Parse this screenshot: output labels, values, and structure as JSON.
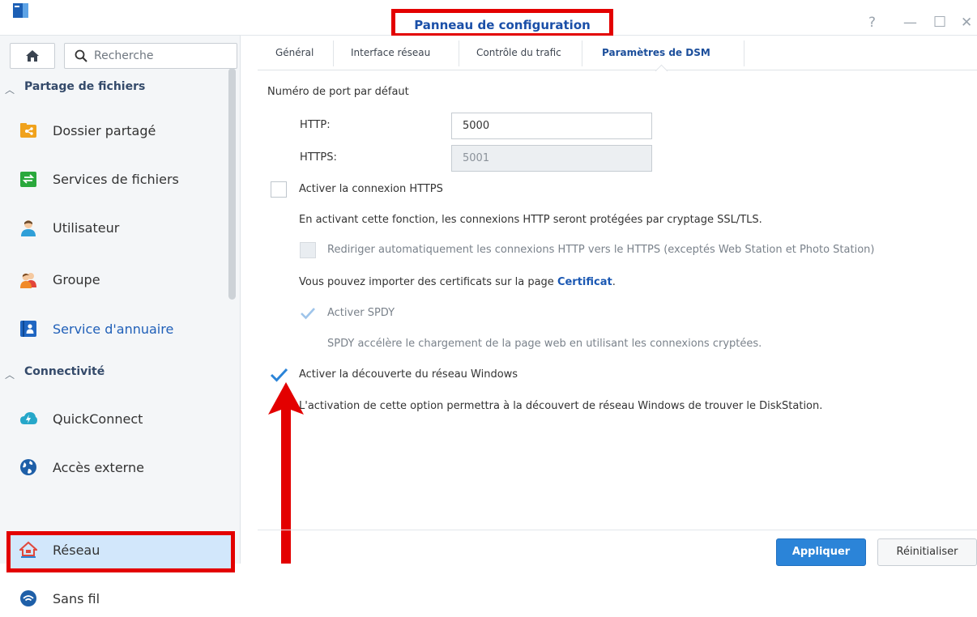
{
  "window": {
    "title": "Panneau de configuration",
    "controls": {
      "help": "?",
      "minimize": "—",
      "maximize": "□",
      "close": "✕"
    }
  },
  "sidebar": {
    "search_placeholder": "Recherche",
    "sections": [
      {
        "title": "Partage de fichiers",
        "items": [
          {
            "label": "Dossier partagé",
            "icon": "shared-folder-icon"
          },
          {
            "label": "Services de fichiers",
            "icon": "file-services-icon"
          },
          {
            "label": "Utilisateur",
            "icon": "user-icon"
          },
          {
            "label": "Groupe",
            "icon": "group-icon"
          },
          {
            "label": "Service d'annuaire",
            "icon": "directory-service-icon"
          }
        ]
      },
      {
        "title": "Connectivité",
        "items": [
          {
            "label": "QuickConnect",
            "icon": "quickconnect-icon"
          },
          {
            "label": "Accès externe",
            "icon": "external-access-icon"
          },
          {
            "label": "Réseau",
            "icon": "network-icon",
            "selected": true
          },
          {
            "label": "Sans fil",
            "icon": "wireless-icon"
          }
        ]
      }
    ]
  },
  "tabs": [
    {
      "label": "Général"
    },
    {
      "label": "Interface réseau"
    },
    {
      "label": "Contrôle du trafic"
    },
    {
      "label": "Paramètres de DSM",
      "active": true
    }
  ],
  "content": {
    "port_section_label": "Numéro de port par défaut",
    "http_label": "HTTP:",
    "http_value": "5000",
    "https_label": "HTTPS:",
    "https_value": "5001",
    "enable_https_label": "Activer la connexion HTTPS",
    "enable_https_checked": false,
    "https_desc": "En activant cette fonction, les connexions HTTP seront protégées par cryptage SSL/TLS.",
    "redirect_label": "Rediriger automatiquement les connexions HTTP vers le HTTPS (exceptés Web Station et Photo Station)",
    "redirect_checked": false,
    "cert_text": "Vous pouvez importer des certificats sur la page",
    "cert_link": "Certificat",
    "cert_period": ".",
    "spdy_label": "Activer SPDY",
    "spdy_checked": true,
    "spdy_desc": "SPDY accélère le chargement de la page web en utilisant les connexions cryptées.",
    "windows_label": "Activer la découverte du réseau Windows",
    "windows_checked": true,
    "windows_desc": "L'activation de cette option permettra à la découvert de réseau Windows de trouver le DiskStation."
  },
  "footer": {
    "apply_label": "Appliquer",
    "reset_label": "Réinitialiser"
  },
  "colors": {
    "accent": "#2b84d8",
    "annotation": "#e30000",
    "selected_bg": "#d2e7fb",
    "title": "#1a4fa8"
  }
}
